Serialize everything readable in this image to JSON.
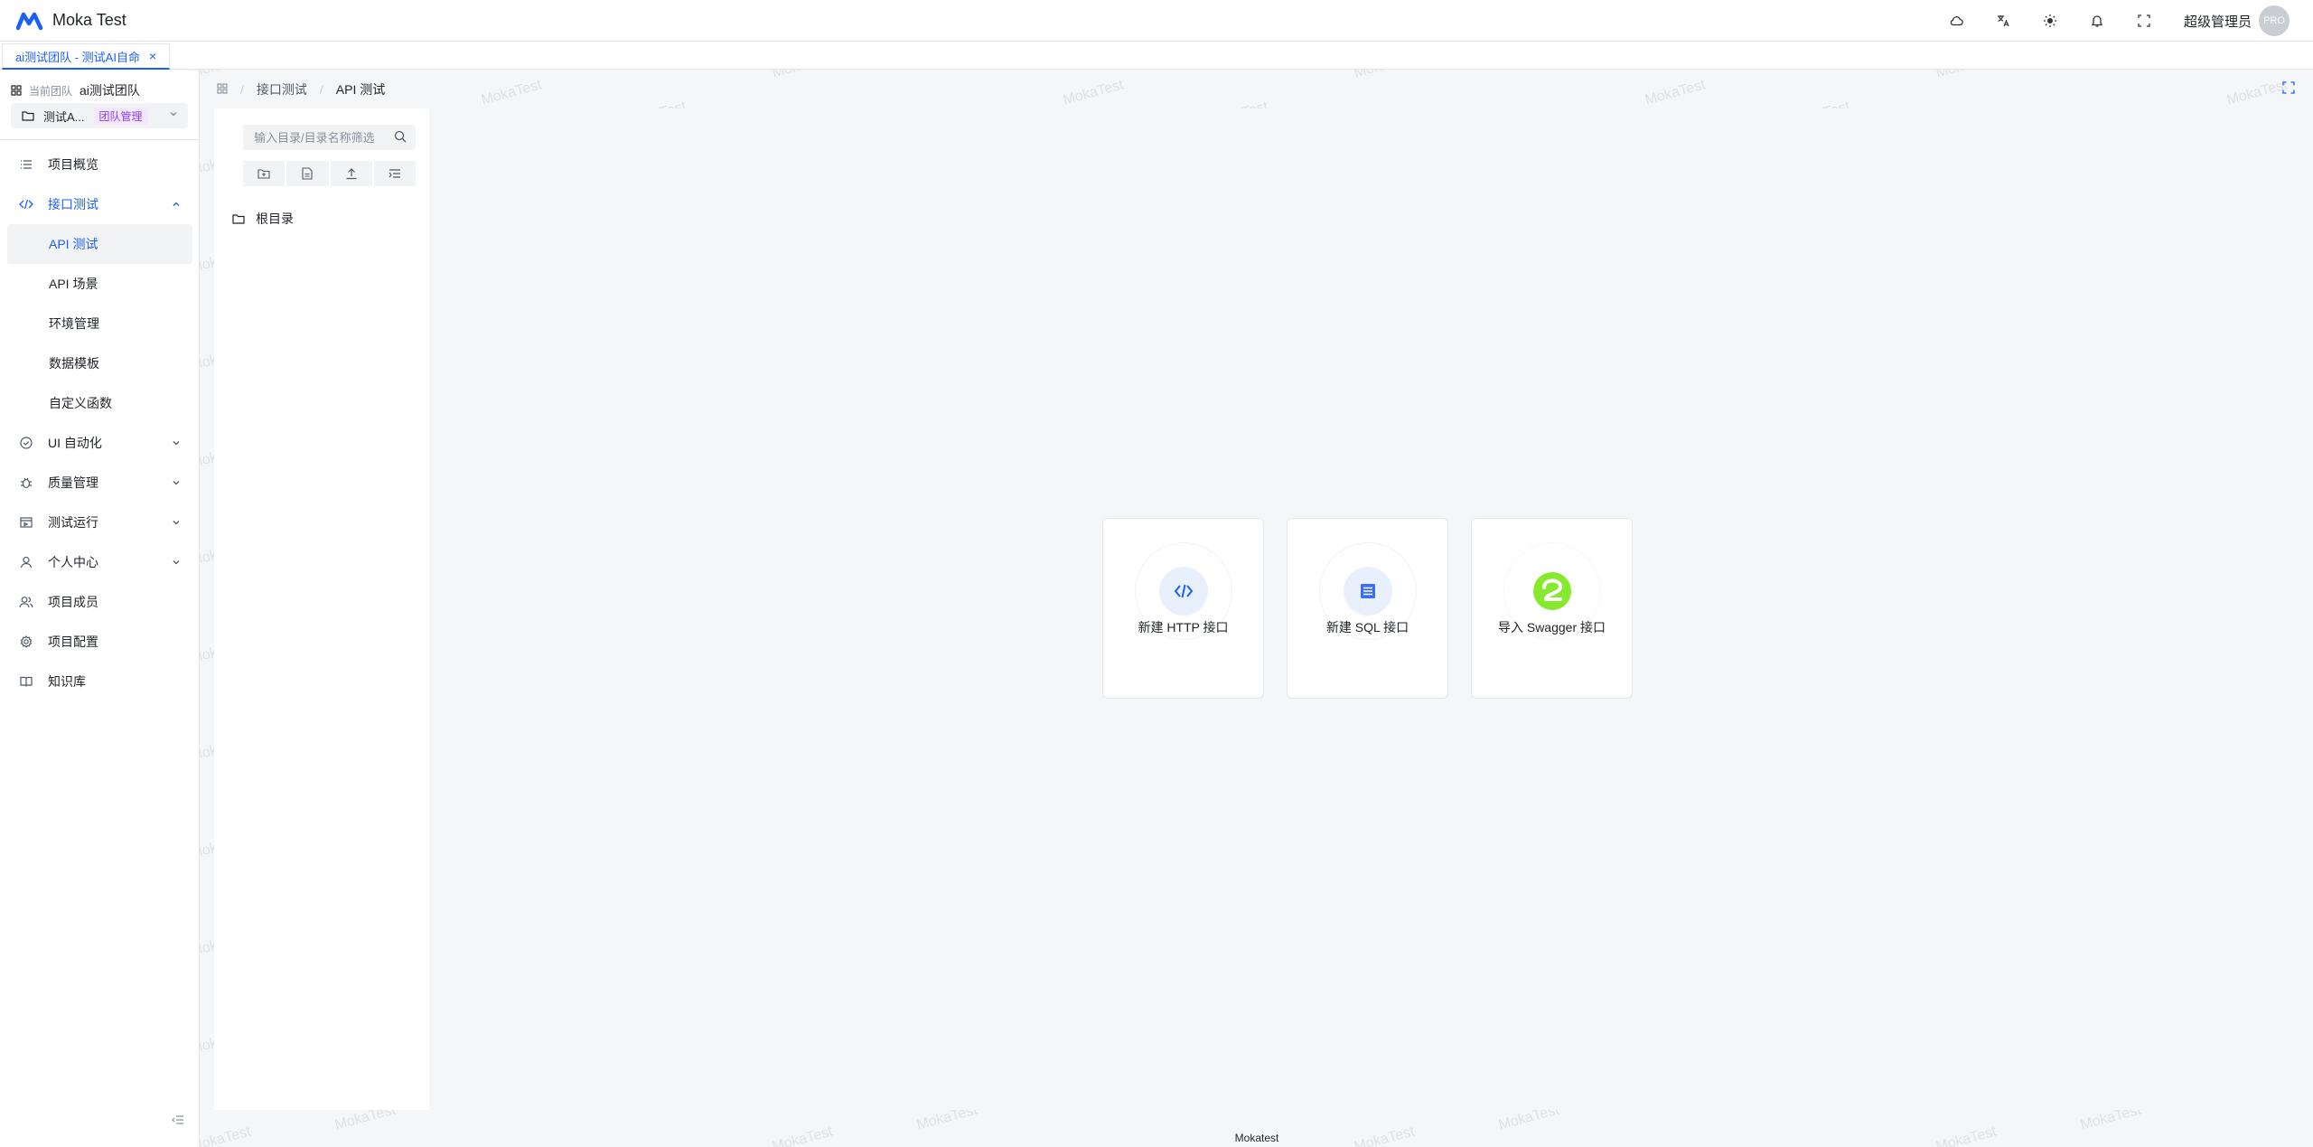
{
  "app": {
    "name": "Moka Test",
    "user": "超级管理员",
    "avatar_text": "PRO"
  },
  "header_icons": [
    "cloud-icon",
    "translate-icon",
    "theme-icon",
    "bell-icon",
    "fullscreen-icon"
  ],
  "tabs": [
    {
      "label": "ai测试团队 - 测试AI自命",
      "close": "×"
    }
  ],
  "sidebar": {
    "team_label": "当前团队",
    "team_name": "ai测试团队",
    "project_name": "测试A...",
    "project_badge": "团队管理",
    "items": [
      {
        "label": "项目概览",
        "icon": "list-icon"
      },
      {
        "label": "接口测试",
        "icon": "code-icon"
      },
      {
        "label": "API 测试"
      },
      {
        "label": "API 场景"
      },
      {
        "label": "环境管理"
      },
      {
        "label": "数据模板"
      },
      {
        "label": "自定义函数"
      },
      {
        "label": "UI 自动化",
        "icon": "check-circle-icon"
      },
      {
        "label": "质量管理",
        "icon": "bug-icon"
      },
      {
        "label": "测试运行",
        "icon": "run-icon"
      },
      {
        "label": "个人中心",
        "icon": "user-icon"
      },
      {
        "label": "项目成员",
        "icon": "users-icon"
      },
      {
        "label": "项目配置",
        "icon": "gear-icon"
      },
      {
        "label": "知识库",
        "icon": "book-icon"
      }
    ]
  },
  "breadcrumb": {
    "parent": "接口测试",
    "current": "API 测试",
    "separator": "/"
  },
  "tree": {
    "search_placeholder": "输入目录/目录名称筛选",
    "root_label": "根目录"
  },
  "cards": [
    {
      "label": "新建 HTTP 接口",
      "icon": "code-icon"
    },
    {
      "label": "新建 SQL 接口",
      "icon": "table-icon"
    },
    {
      "label": "导入 Swagger 接口",
      "icon": "swagger-icon"
    }
  ],
  "footer": {
    "text": "Mokatest"
  },
  "watermark": {
    "text": "MokaTest"
  },
  "colors": {
    "primary": "#1a5efc",
    "badge": "#8b3ff5",
    "swagger": "#85ea2d"
  }
}
